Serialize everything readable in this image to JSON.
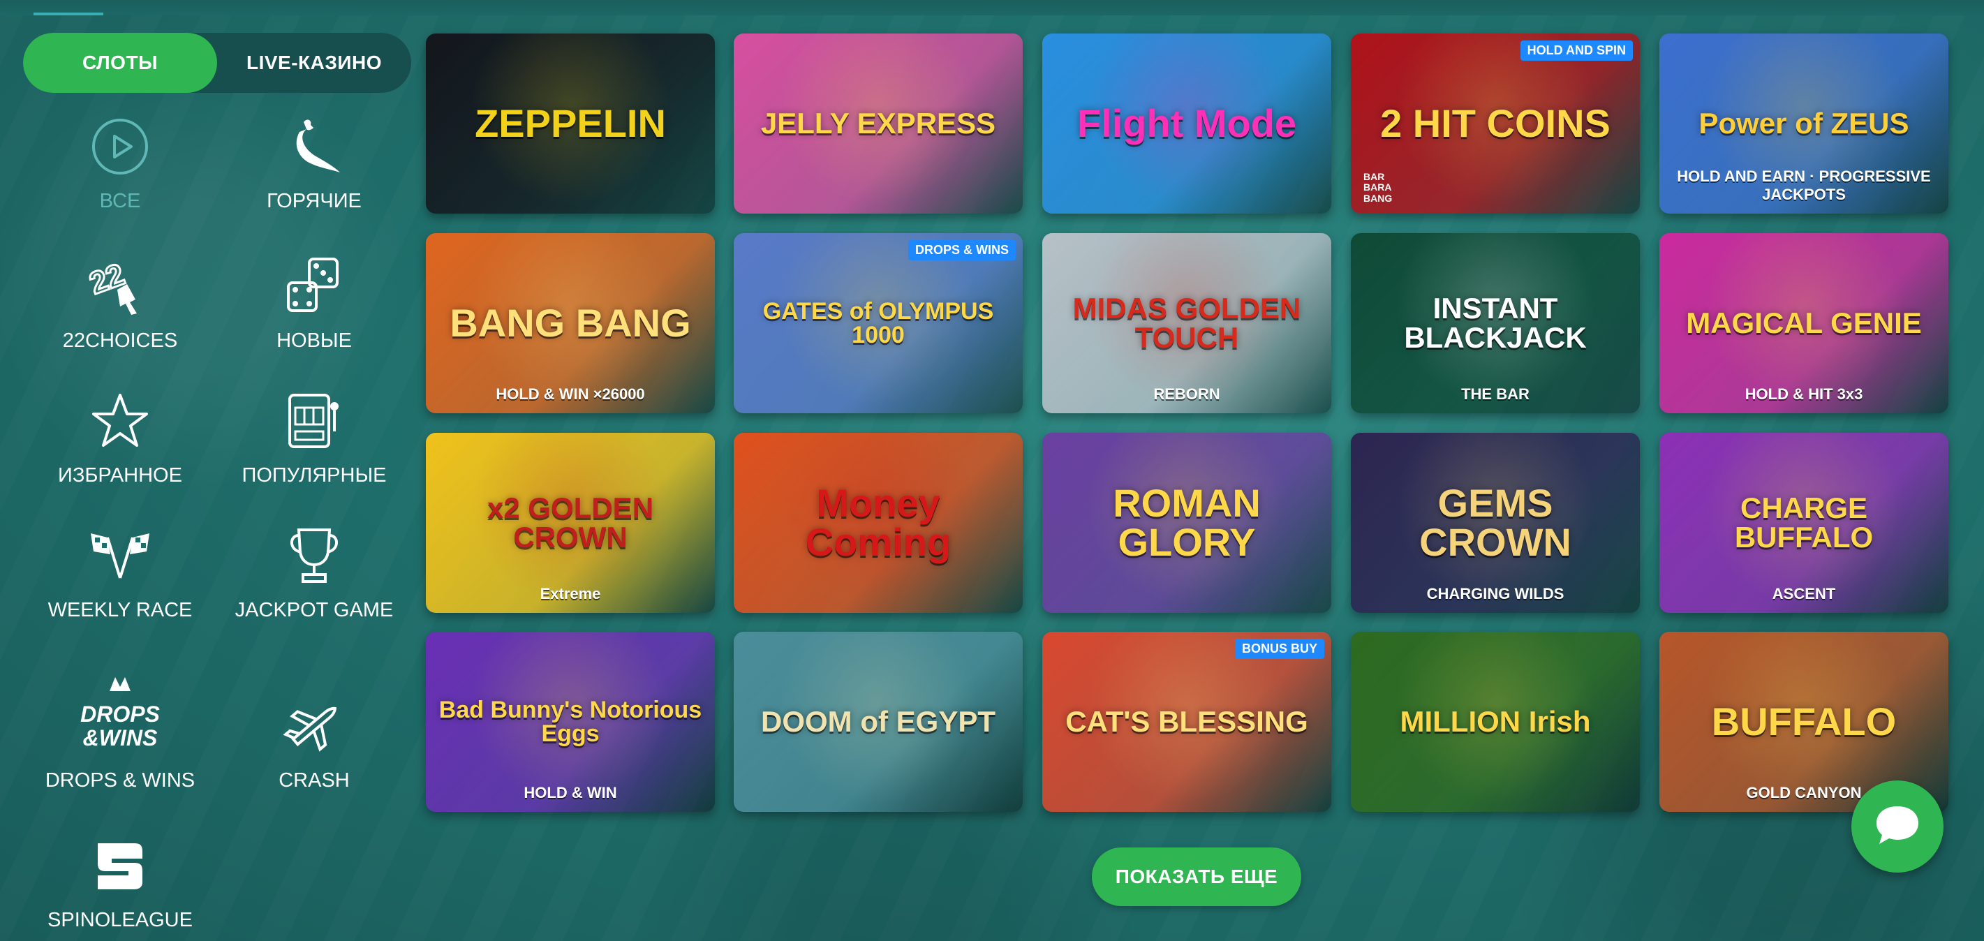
{
  "tabs": [
    {
      "label": "СЛОТЫ",
      "active": true
    },
    {
      "label": "LIVE-КАЗИНО",
      "active": false
    }
  ],
  "categories": [
    {
      "label": "ВСЕ",
      "icon": "play-icon",
      "active": true
    },
    {
      "label": "ГОРЯЧИЕ",
      "icon": "chili-icon",
      "active": false
    },
    {
      "label": "22CHOICES",
      "icon": "22choices-icon",
      "active": false
    },
    {
      "label": "НОВЫЕ",
      "icon": "dice-icon",
      "active": false
    },
    {
      "label": "ИЗБРАННОЕ",
      "icon": "star-icon",
      "active": false
    },
    {
      "label": "ПОПУЛЯРНЫЕ",
      "icon": "slot-machine-icon",
      "active": false
    },
    {
      "label": "WEEKLY RACE",
      "icon": "race-flags-icon",
      "active": false
    },
    {
      "label": "JACKPOT GAME",
      "icon": "trophy-icon",
      "active": false
    },
    {
      "label": "DROPS & WINS",
      "icon": "drops-wins-icon",
      "active": false
    },
    {
      "label": "CRASH",
      "icon": "plane-icon",
      "active": false
    },
    {
      "label": "SPINOLEAGUE",
      "icon": "spinoleague-icon",
      "active": false
    }
  ],
  "games": [
    {
      "title": "ZEPPELIN",
      "bg": "#14161c",
      "fg": "#f2d21b"
    },
    {
      "title": "JELLY EXPRESS",
      "bg": "#d74fa0",
      "fg": "#ffd84a"
    },
    {
      "title": "Flight Mode",
      "bg": "#2a8fe0",
      "fg": "#ff2fb8"
    },
    {
      "title": "2 HIT COINS",
      "bg": "#b0121a",
      "fg": "#ffd84a",
      "badge": "HOLD AND SPIN",
      "corner": "BAR BARA BANG"
    },
    {
      "title": "Power of ZEUS",
      "bg": "#3d6fcf",
      "fg": "#ffcf3a",
      "sub": "HOLD AND EARN · PROGRESSIVE JACKPOTS"
    },
    {
      "title": "BANG BANG",
      "bg": "#e0651f",
      "fg": "#ffe07a",
      "sub": "HOLD & WIN ×26000"
    },
    {
      "title": "GATES of OLYMPUS 1000",
      "bg": "#5a7ac9",
      "fg": "#ffd84a",
      "badge": "DROPS & WINS"
    },
    {
      "title": "MIDAS GOLDEN TOUCH",
      "bg": "#b7c0c7",
      "fg": "#d62a1d",
      "sub": "REBORN"
    },
    {
      "title": "INSTANT BLACKJACK",
      "bg": "#0f4a36",
      "fg": "#ffffff",
      "sub": "THE BAR"
    },
    {
      "title": "MAGICAL GENIE",
      "bg": "#cc2a9e",
      "fg": "#ffd84a",
      "sub": "HOLD & HIT 3x3"
    },
    {
      "title": "x2 GOLDEN CROWN",
      "bg": "#f1c21b",
      "fg": "#c21e1e",
      "sub": "Extreme"
    },
    {
      "title": "Money Coming",
      "bg": "#e0501d",
      "fg": "#d61818"
    },
    {
      "title": "ROMAN GLORY",
      "bg": "#6b3fa0",
      "fg": "#ffd84a"
    },
    {
      "title": "GEMS CROWN",
      "bg": "#2d2451",
      "fg": "#f5d37a",
      "sub": "CHARGING WILDS"
    },
    {
      "title": "CHARGE BUFFALO",
      "bg": "#8d2fb5",
      "fg": "#ffd84a",
      "sub": "ASCENT"
    },
    {
      "title": "Bad Bunny's Notorious Eggs",
      "bg": "#6a2fb5",
      "fg": "#ffd84a",
      "sub": "HOLD & WIN"
    },
    {
      "title": "DOOM of EGYPT",
      "bg": "#4c8d9a",
      "fg": "#f0e3b0"
    },
    {
      "title": "CAT'S BLESSING",
      "bg": "#d9482f",
      "fg": "#ffe07a",
      "badge": "BONUS BUY"
    },
    {
      "title": "MILLION Irish",
      "bg": "#2e6a1f",
      "fg": "#ffd84a"
    },
    {
      "title": "BUFFALO",
      "bg": "#b8562a",
      "fg": "#ffd84a",
      "sub": "GOLD CANYON"
    }
  ],
  "show_more_label": "ПОКАЗАТЬ ЕЩЕ",
  "colors": {
    "accent": "#2fb552",
    "background": "#1f6f6c",
    "toggle_bg": "#164f4e",
    "active_category": "#5fb8b6"
  }
}
